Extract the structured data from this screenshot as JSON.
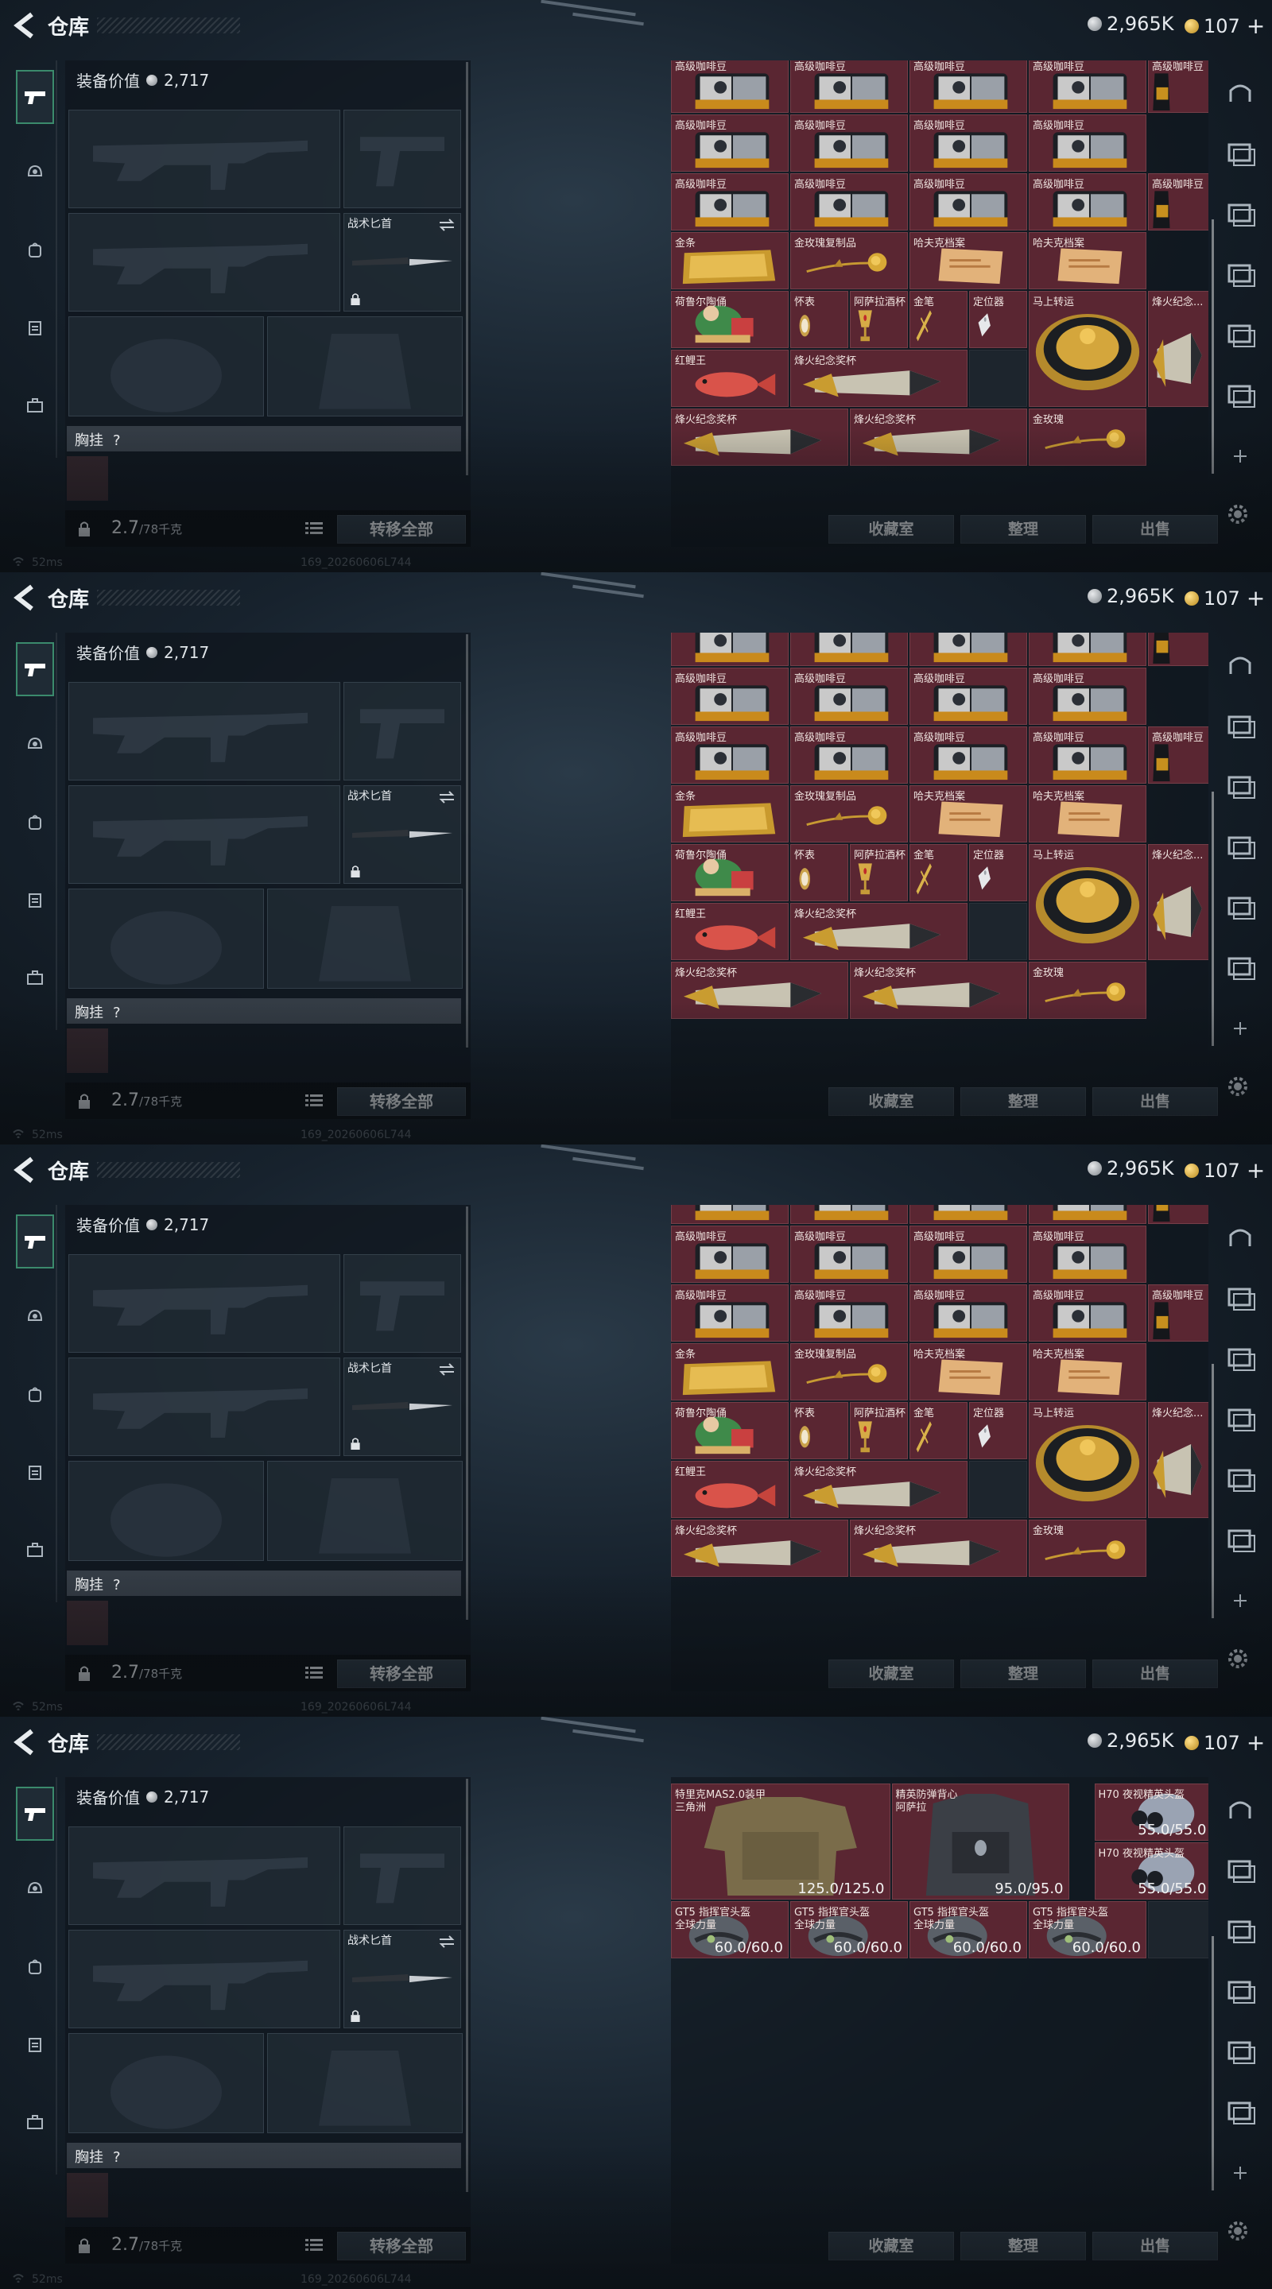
{
  "header": {
    "title": "仓库",
    "silver": "2,965K",
    "gold": "107",
    "plus": "+"
  },
  "equipment": {
    "value_label": "装备价值",
    "value": "2,717",
    "knife_label": "战术匕首",
    "chest_label": "胸挂",
    "chest_help": "?",
    "weight": "2.7",
    "weight_max": "/78千克",
    "transfer_all": "转移全部"
  },
  "status": {
    "ping": "52ms",
    "build": "169_20260606L744"
  },
  "grid_buttons": {
    "collection": "收藏室",
    "sort": "整理",
    "sell": "出售"
  },
  "colors": {
    "cell_red": "#5a2632",
    "accent_green": "#3b8a6c"
  },
  "frames": [
    {
      "items": [
        {
          "label": "高级咖啡豆",
          "art": "coffee"
        },
        {
          "label": "高级咖啡豆",
          "art": "coffee"
        },
        {
          "label": "高级咖啡豆",
          "art": "coffee"
        },
        {
          "label": "高级咖啡豆",
          "art": "coffee"
        },
        {
          "label": "高级咖啡豆",
          "art": "coffeebag"
        },
        {
          "label": "高级咖啡豆",
          "art": "coffee"
        },
        {
          "label": "高级咖啡豆",
          "art": "coffee"
        },
        {
          "label": "高级咖啡豆",
          "art": "coffee"
        },
        {
          "label": "高级咖啡豆",
          "art": "coffee"
        },
        {
          "label": "高级咖啡豆",
          "art": "coffee"
        },
        {
          "label": "高级咖啡豆",
          "art": "coffee"
        },
        {
          "label": "高级咖啡豆",
          "art": "coffee"
        },
        {
          "label": "高级咖啡豆",
          "art": "coffee"
        },
        {
          "label": "高级咖啡豆",
          "art": "coffeebag"
        },
        {
          "label": "金条",
          "art": "goldbar"
        },
        {
          "label": "金玫瑰复制品",
          "art": "rose"
        },
        {
          "label": "哈夫克档案",
          "art": "document"
        },
        {
          "label": "哈夫克档案",
          "art": "document"
        },
        {
          "label": "荷鲁尔陶俑",
          "art": "figurine"
        },
        {
          "label": "怀表",
          "art": "watch"
        },
        {
          "label": "阿萨拉酒杯",
          "art": "goblet"
        },
        {
          "label": "金笔",
          "art": "pen"
        },
        {
          "label": "定位器",
          "art": "tracker"
        },
        {
          "label": "马上转运",
          "art": "wheel"
        },
        {
          "label": "烽火纪念...",
          "art": "trophy"
        },
        {
          "label": "红鲤王",
          "art": "fish"
        },
        {
          "label": "烽火纪念奖杯",
          "art": "trophy"
        },
        {
          "label": "烽火纪念奖杯",
          "art": "trophy"
        },
        {
          "label": "烽火纪念奖杯",
          "art": "trophy"
        },
        {
          "label": "金玫瑰",
          "art": "rose"
        }
      ]
    },
    {
      "items": [
        {
          "label": "特里克MAS2.0装甲",
          "label2": "三角洲",
          "durability": "125.0/125.0",
          "art": "vest"
        },
        {
          "label": "精英防弹背心",
          "label2": "阿萨拉",
          "durability": "95.0/95.0",
          "art": "vest2"
        },
        {
          "label": "H70 夜视精英头盔",
          "durability": "55.0/55.0",
          "art": "nvg"
        },
        {
          "label": "H70 夜视精英头盔",
          "durability": "55.0/55.0",
          "art": "nvg"
        },
        {
          "label": "GT5 指挥官头盔",
          "label2": "全球力量",
          "durability": "60.0/60.0",
          "art": "helmet"
        },
        {
          "label": "GT5 指挥官头盔",
          "label2": "全球力量",
          "durability": "60.0/60.0",
          "art": "helmet"
        },
        {
          "label": "GT5 指挥官头盔",
          "label2": "全球力量",
          "durability": "60.0/60.0",
          "art": "helmet"
        },
        {
          "label": "GT5 指挥官头盔",
          "label2": "全球力量",
          "durability": "60.0/60.0",
          "art": "helmet"
        }
      ]
    }
  ]
}
